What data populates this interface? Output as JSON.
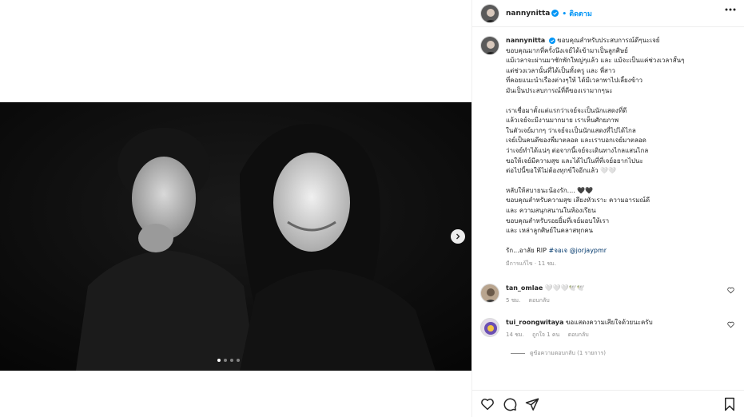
{
  "post": {
    "username": "nannynitta",
    "follow_label": "ติดตาม",
    "caption_lines": [
      "ขอบคุณสำหรับประสบการณ์ดีๆนะเจย์",
      "ขอบคุณมากที่ครั้งนึงเจย์ได้เข้ามาเป็นลูกศิษย์",
      "แม้เวลาจะผ่านมาซักพักใหญ่ๆแล้ว และ แม้จะเป็นแค่ช่วงเวลาสั้นๆ",
      "แต่ช่วงเวลานั้นที่ได้เป็นทั้งครู และ พี่สาว",
      "ที่คอยแนะนำเรื่องต่างๆให้ ได้มีเวลาพาไปเลี้ยงข้าว",
      "มันเป็นประสบการณ์ที่ดีของเรามากๆนะ",
      "",
      "เราเชื่อมาตั้งแต่แรกว่าเจย์จะเป็นนักแสดงที่ดี",
      "แล้วเจย์จะมีงานมากมาย เราเห็นศักยภาพ",
      "ในตัวเจย์มากๆ ว่าเจย์จะเป็นนักแสดงที่ไปได้ไกล",
      "เจย์เป็นคนดีของพี่มาตลอด และเราบอกเจย์มาตลอด",
      "ว่าเจย์ทำได้แน่ๆ ต่อจากนี้เจย์จะเดินทางไกลแสนไกล",
      "ขอให้เจย์มีความสุข และได้ไปในที่ที่เจย์อยากไปนะ",
      "ต่อไปนี้ขอให้ไม่ต้องทุกข์ใจอีกแล้ว 🤍🤍",
      "",
      "หลับให้สบายนะน้องรัก.... 🖤🖤",
      "ขอบคุณสำหรับความสุข เสียงหัวเราะ ความอารมณ์ดี",
      "และ ความสนุกสนานในห้องเรียน",
      "ขอบคุณสำหรับรอยยิ้มที่เจย์มอบให้เรา",
      "และ เหล่าลูกศิษย์ในคลาสทุกคน",
      ""
    ],
    "signoff": "รัก...อาลัย RIP ",
    "hashtag": "#จอเจ",
    "mention": "@jorjaypmr",
    "edited_time": "มีการแก้ไข · 11 ชม."
  },
  "comments": [
    {
      "username": "tan_omlae",
      "text": "🤍🤍🤍🕊️🕊️",
      "time": "5 ชม.",
      "likes": "",
      "reply": "ตอบกลับ"
    },
    {
      "username": "tui_roongwitaya",
      "text": "ขอแสดงความเสียใจด้วยนะครับ",
      "time": "14 ชม.",
      "likes": "ถูกใจ 1 คน",
      "reply": "ตอบกลับ"
    }
  ],
  "view_replies": "ดูข้อความตอบกลับ (1 รายการ)",
  "colors": {
    "accent": "#0095f6",
    "verified": "#0095f6",
    "muted": "#8e8e8e",
    "border": "#efefef"
  },
  "icons": [
    "more-icon",
    "verified-icon",
    "heart-icon",
    "comment-icon",
    "share-icon",
    "bookmark-icon",
    "chevron-right-icon"
  ],
  "carousel": {
    "count": 4,
    "active_index": 0
  }
}
